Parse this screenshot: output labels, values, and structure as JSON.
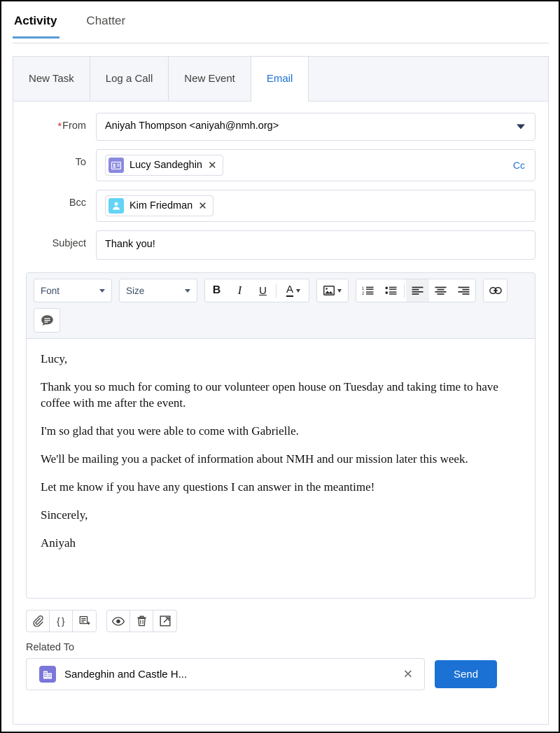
{
  "top_tabs": [
    {
      "label": "Activity",
      "active": true
    },
    {
      "label": "Chatter",
      "active": false
    }
  ],
  "publisher_tabs": [
    {
      "label": "New Task",
      "active": false
    },
    {
      "label": "Log a Call",
      "active": false
    },
    {
      "label": "New Event",
      "active": false
    },
    {
      "label": "Email",
      "active": true
    }
  ],
  "compose": {
    "from": {
      "label": "From",
      "required": true,
      "value": "Aniyah Thompson <aniyah@nmh.org>"
    },
    "to": {
      "label": "To",
      "pill": {
        "name": "Lucy Sandeghin",
        "icon": "contact-card-icon",
        "color": "#8b8ae0"
      },
      "cc_label": "Cc"
    },
    "bcc": {
      "label": "Bcc",
      "pill": {
        "name": "Kim Friedman",
        "icon": "lead-person-icon",
        "color": "#63d4f5"
      }
    },
    "subject": {
      "label": "Subject",
      "value": "Thank you!",
      "placeholder": "Subject"
    }
  },
  "toolbar": {
    "font_select": "Font",
    "size_select": "Size",
    "buttons": [
      {
        "name": "bold-icon",
        "label": "B"
      },
      {
        "name": "italic-icon",
        "label": "I"
      },
      {
        "name": "underline-icon",
        "label": "U"
      },
      {
        "name": "text-color-icon",
        "label": "A"
      },
      {
        "name": "image-icon",
        "label": "Image"
      },
      {
        "name": "ordered-list-icon",
        "label": "Numbered List"
      },
      {
        "name": "bulleted-list-icon",
        "label": "Bulleted List"
      },
      {
        "name": "align-left-icon",
        "label": "Align Left"
      },
      {
        "name": "align-center-icon",
        "label": "Align Center"
      },
      {
        "name": "align-right-icon",
        "label": "Align Right"
      },
      {
        "name": "link-icon",
        "label": "Link"
      },
      {
        "name": "quick-text-icon",
        "label": "Quick Text"
      }
    ]
  },
  "email_body": {
    "paragraphs": [
      "Lucy,",
      "Thank you so much for coming to our volunteer open house on Tuesday and taking time to have coffee with me after the event.",
      "I'm so glad that you were able to come with Gabrielle.",
      "We'll be mailing you a packet of information about NMH and our mission later this week.",
      "Let me know if you have any questions I can answer in the meantime!",
      "Sincerely,",
      "Aniyah"
    ]
  },
  "footer": {
    "icon_groups": [
      [
        {
          "name": "attach-file-icon",
          "label": "Attach File"
        },
        {
          "name": "merge-field-icon",
          "label": "Merge Field"
        },
        {
          "name": "insert-template-icon",
          "label": "Insert Template"
        }
      ],
      [
        {
          "name": "preview-icon",
          "label": "Preview"
        },
        {
          "name": "delete-icon",
          "label": "Delete Draft"
        },
        {
          "name": "pop-out-icon",
          "label": "Pop Out"
        }
      ]
    ],
    "related_to_label": "Related To",
    "related_to_value": "Sandeghin and Castle H...",
    "related_to_icon": "account-building-icon",
    "send_label": "Send"
  },
  "colors": {
    "accent_blue": "#1b71d4",
    "tab_underline": "#5a9bd8",
    "required_red": "#c23934",
    "border": "#d8dde6",
    "toolbar_bg": "#f4f6f9"
  }
}
